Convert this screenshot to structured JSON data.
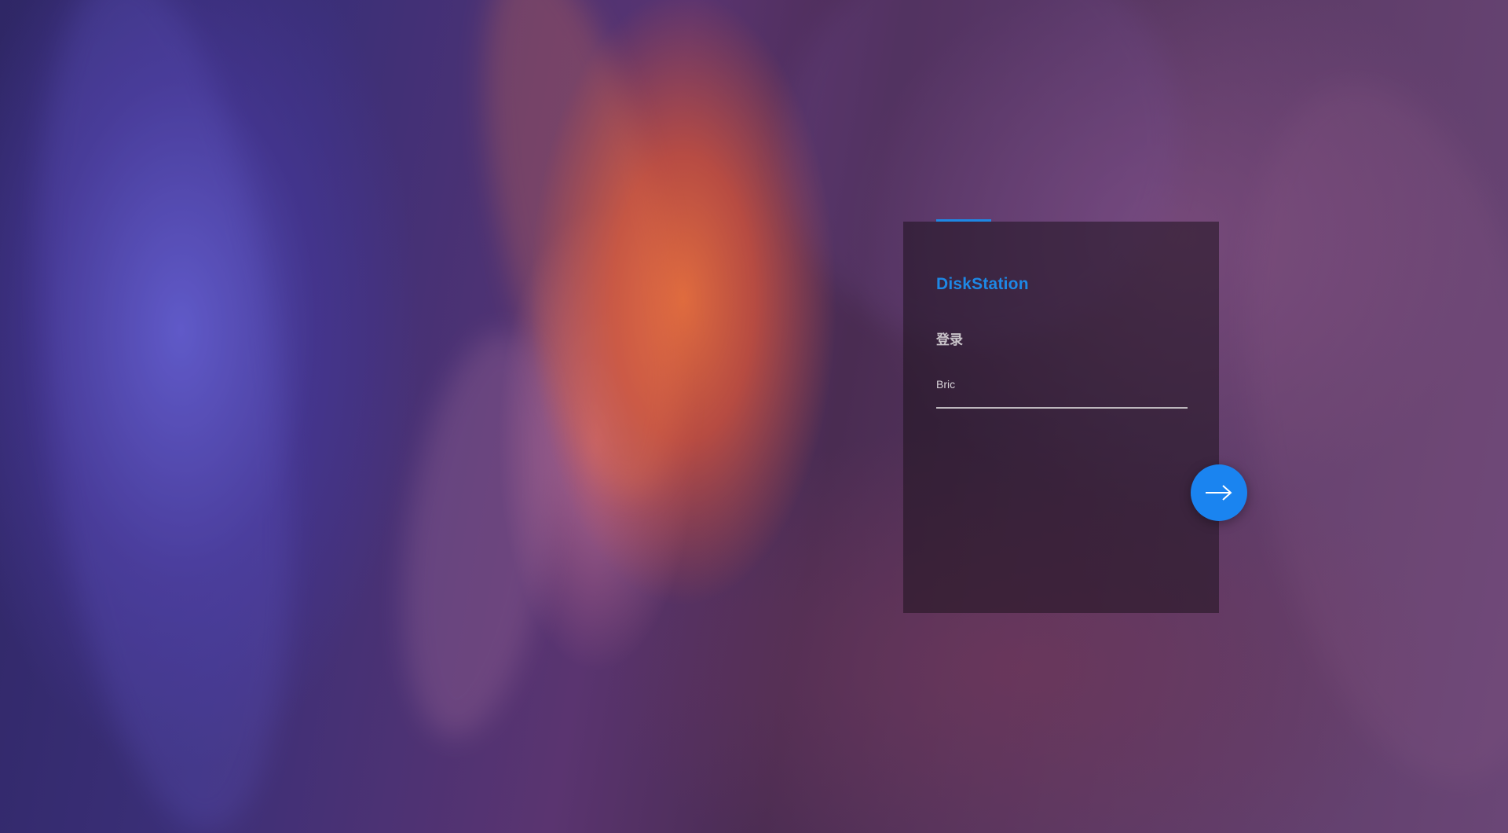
{
  "login": {
    "brand": "DiskStation",
    "heading": "登录",
    "username_value": "Bric",
    "next_button_icon": "arrow-right-icon"
  },
  "colors": {
    "accent": "#1e88e5",
    "button": "#1a84f0"
  }
}
